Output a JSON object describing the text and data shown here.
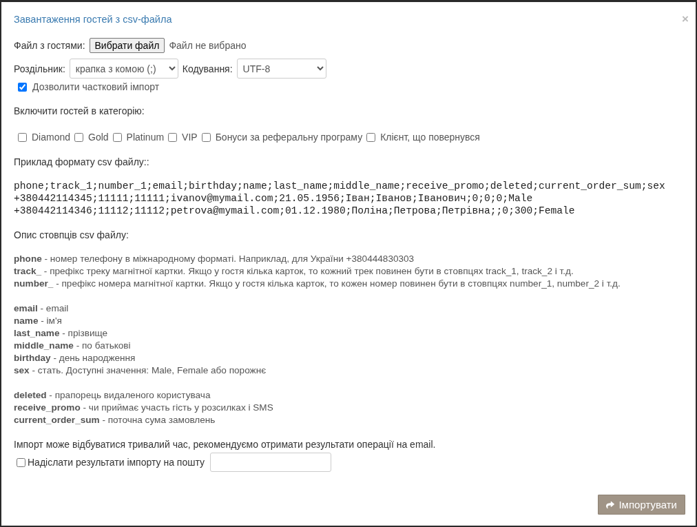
{
  "window": {
    "title": "Завантаження гостей з csv-файла",
    "close": "×"
  },
  "file": {
    "label": "Файл з гостями:",
    "button": "Вибрати файл",
    "status": "Файл не вибрано"
  },
  "separator": {
    "label": "Роздільник:",
    "value": "крапка з комою (;)"
  },
  "encoding": {
    "label": "Кодування:",
    "value": "UTF-8"
  },
  "partial_import": {
    "label": "Дозволити частковий імпорт",
    "checked": true
  },
  "categories": {
    "heading": "Включити гостей в категорію:",
    "items": [
      {
        "label": "Diamond",
        "checked": false
      },
      {
        "label": "Gold",
        "checked": false
      },
      {
        "label": "Platinum",
        "checked": false
      },
      {
        "label": "VIP",
        "checked": false
      },
      {
        "label": "Бонуси за реферальну програму",
        "checked": false
      },
      {
        "label": "Клієнт, що повернувся",
        "checked": false
      }
    ]
  },
  "example": {
    "heading": "Приклад формату csv файлу::",
    "lines": [
      "phone;track_1;number_1;email;birthday;name;last_name;middle_name;receive_promo;deleted;current_order_sum;sex",
      "+380442114345;11111;11111;ivanov@mymail.com;21.05.1956;Іван;Іванов;Іванович;0;0;0;Male",
      "+380442114346;11112;11112;petrova@mymail.com;01.12.1980;Поліна;Петрова;Петрівна;;0;300;Female"
    ]
  },
  "columns": {
    "heading": "Опис стовпців csv файлу:",
    "groups": [
      [
        "**phone** - номер телефону в міжнародному форматі. Наприклад, для України +380444830303",
        "**track_** - префікс треку магнітної картки. Якщо у гостя кілька карток, то кожний трек повинен бути в стовпцях track_1, track_2 і т.д.",
        "**number_** - префікс номера магнітної картки. Якщо у гостя кілька карток, то кожен номер повинен бути в стовпцях number_1, number_2 і т.д."
      ],
      [
        "**email** - email",
        "**name** - ім'я",
        "**last_name** - прізвище",
        "**middle_name** - по батькові",
        "**birthday** - день народження",
        "**sex** - стать. Доступні значення: Male, Female або порожнє"
      ],
      [
        "**deleted** - прапорець видаленого користувача",
        "**receive_promo** - чи приймає участь гість у розсилках і SMS",
        "**current_order_sum** - поточна сума замовлень"
      ]
    ]
  },
  "note": "Імпорт може відбуватися тривалий час, рекомендуємо отримати результати операції на email.",
  "send_results": {
    "label": "Надіслати результати імпорту на пошту",
    "checked": false
  },
  "import_button": "Імпортувати"
}
